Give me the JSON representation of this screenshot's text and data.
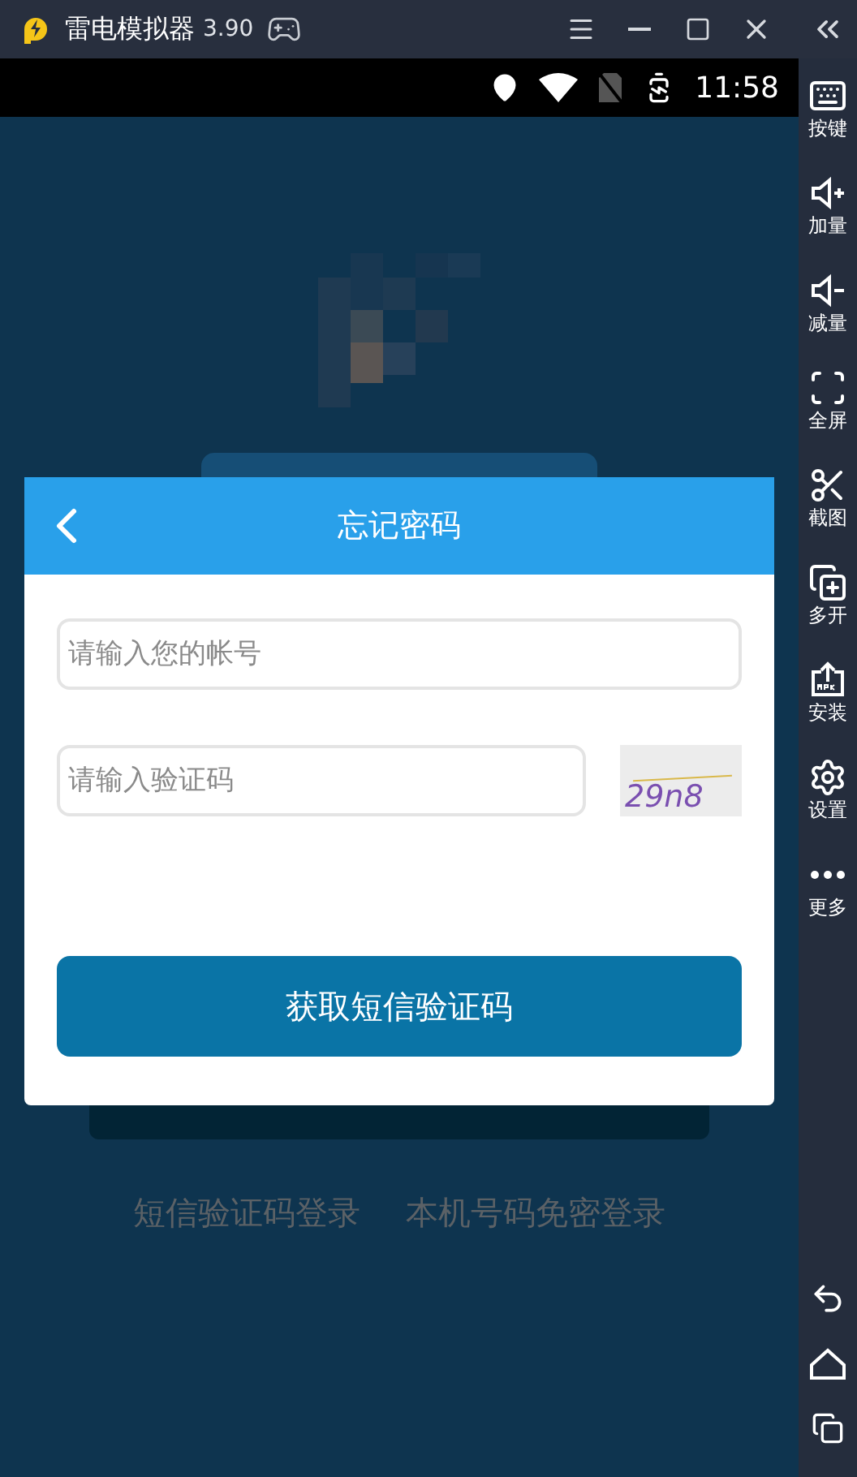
{
  "window": {
    "title": "雷电模拟器",
    "version": "3.90"
  },
  "status_bar": {
    "time": "11:58"
  },
  "sidebar": {
    "items": [
      {
        "kind": "keys",
        "label": "按键"
      },
      {
        "kind": "volup",
        "label": "加量"
      },
      {
        "kind": "voldown",
        "label": "减量"
      },
      {
        "kind": "fullscreen",
        "label": "全屏"
      },
      {
        "kind": "screenshot",
        "label": "截图"
      },
      {
        "kind": "multi",
        "label": "多开"
      },
      {
        "kind": "install",
        "label": "安装"
      },
      {
        "kind": "settings",
        "label": "设置"
      },
      {
        "kind": "more",
        "label": "更多"
      }
    ]
  },
  "dialog": {
    "title": "忘记密码",
    "account_field": {
      "placeholder": "请输入您的帐号"
    },
    "captcha_field": {
      "placeholder": "请输入验证码"
    },
    "captcha_image": {
      "text": "29n8"
    },
    "submit_button": "获取短信验证码"
  },
  "login_links": [
    "短信验证码登录",
    "本机号码免密登录"
  ]
}
